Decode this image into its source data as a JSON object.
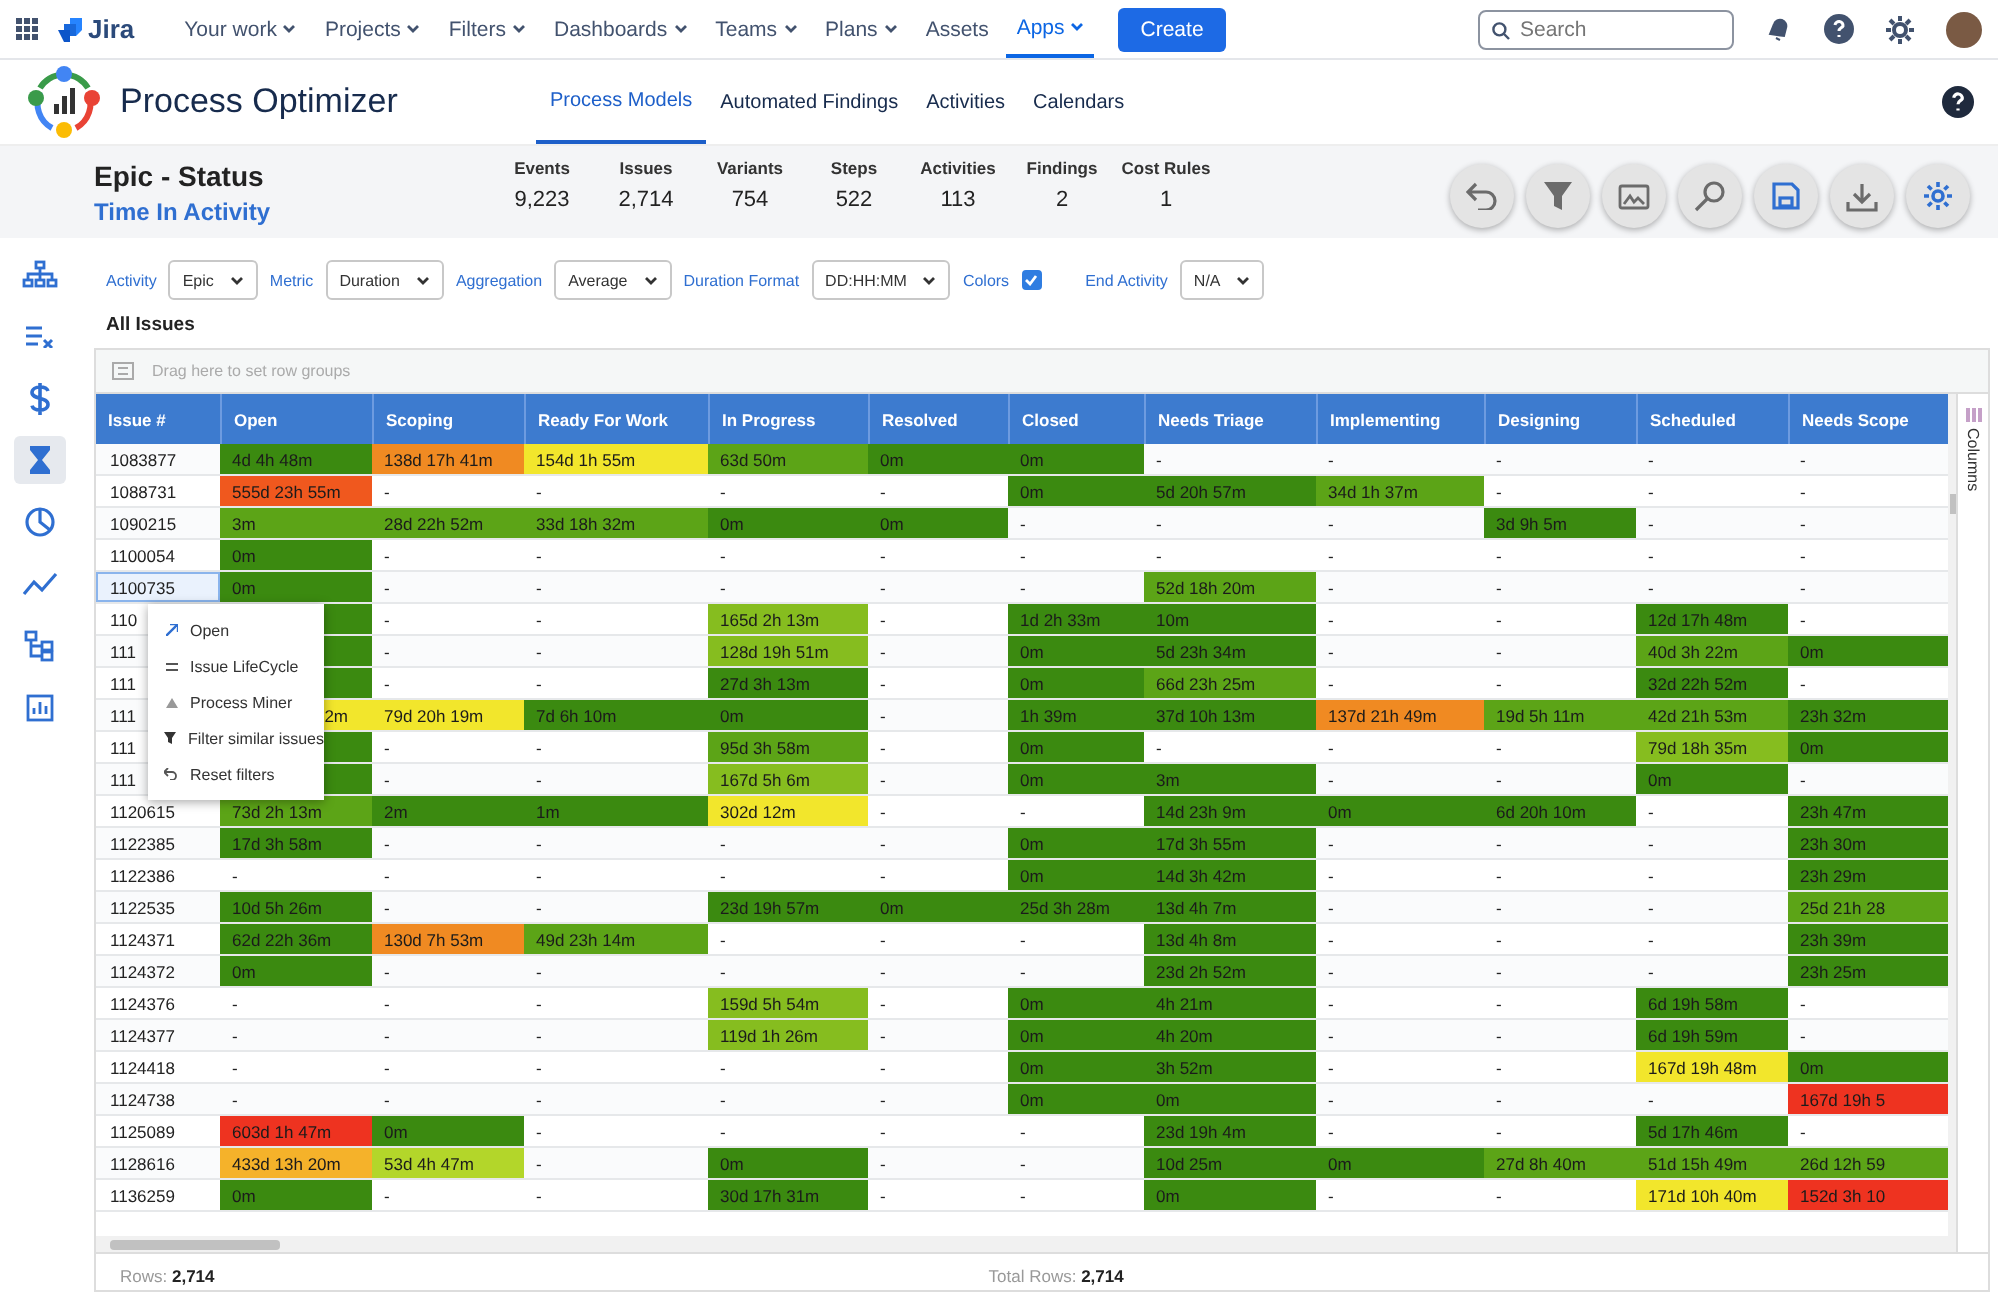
{
  "nav": {
    "product": "Jira",
    "items": [
      {
        "label": "Your work",
        "dropdown": true,
        "selected": false
      },
      {
        "label": "Projects",
        "dropdown": true,
        "selected": false
      },
      {
        "label": "Filters",
        "dropdown": true,
        "selected": false
      },
      {
        "label": "Dashboards",
        "dropdown": true,
        "selected": false
      },
      {
        "label": "Teams",
        "dropdown": true,
        "selected": false
      },
      {
        "label": "Plans",
        "dropdown": true,
        "selected": false
      },
      {
        "label": "Assets",
        "dropdown": false,
        "selected": false
      },
      {
        "label": "Apps",
        "dropdown": true,
        "selected": true
      }
    ],
    "create": "Create",
    "search": {
      "placeholder": "Search"
    }
  },
  "app": {
    "title": "Process Optimizer",
    "tabs": [
      {
        "label": "Process Models",
        "selected": true
      },
      {
        "label": "Automated Findings",
        "selected": false
      },
      {
        "label": "Activities",
        "selected": false
      },
      {
        "label": "Calendars",
        "selected": false
      }
    ]
  },
  "summary": {
    "title": "Epic - Status",
    "subtitle": "Time In Activity",
    "stats": [
      {
        "label": "Events",
        "value": "9,223"
      },
      {
        "label": "Issues",
        "value": "2,714"
      },
      {
        "label": "Variants",
        "value": "754"
      },
      {
        "label": "Steps",
        "value": "522"
      },
      {
        "label": "Activities",
        "value": "113"
      },
      {
        "label": "Findings",
        "value": "2"
      },
      {
        "label": "Cost Rules",
        "value": "1"
      }
    ]
  },
  "toolbar": [
    {
      "kind": "undo"
    },
    {
      "kind": "filter"
    },
    {
      "kind": "image"
    },
    {
      "kind": "magnifier"
    },
    {
      "kind": "save"
    },
    {
      "kind": "download"
    },
    {
      "kind": "settings"
    }
  ],
  "sidebar": {
    "items": [
      {
        "kind": "process-map",
        "selected": false
      },
      {
        "kind": "checklist",
        "selected": false
      },
      {
        "kind": "dollar",
        "selected": false
      },
      {
        "kind": "hourglass",
        "selected": true
      },
      {
        "kind": "pie",
        "selected": false
      },
      {
        "kind": "trend",
        "selected": false
      },
      {
        "kind": "hierarchy",
        "selected": false
      },
      {
        "kind": "report",
        "selected": false
      }
    ]
  },
  "filters": [
    {
      "kind": "select",
      "label": "Activity",
      "value": "Epic"
    },
    {
      "kind": "select",
      "label": "Metric",
      "value": "Duration"
    },
    {
      "kind": "select",
      "label": "Aggregation",
      "value": "Average"
    },
    {
      "kind": "select",
      "label": "Duration Format",
      "value": "DD:HH:MM"
    },
    {
      "kind": "checkbox",
      "label": "Colors",
      "checked": true
    },
    {
      "kind": "select",
      "label": "End Activity",
      "value": "N/A"
    }
  ],
  "section_title": "All Issues",
  "table": {
    "group_hint": "Drag here to set row groups",
    "side_panel": "Columns",
    "columns": [
      "Issue #",
      "Open",
      "Scoping",
      "Ready For Work",
      "In Progress",
      "Resolved",
      "Closed",
      "Needs Triage",
      "Implementing",
      "Designing",
      "Scheduled",
      "Needs Scope"
    ],
    "rows": [
      {
        "selected": false,
        "cells": [
          {
            "text": "1083877"
          },
          {
            "text": "4d 4h 48m",
            "color": "#3b8a10"
          },
          {
            "text": "138d 17h 41m",
            "color": "#f08a22"
          },
          {
            "text": "154d 1h 55m",
            "color": "#f2e62c"
          },
          {
            "text": "63d 50m",
            "color": "#5ca417"
          },
          {
            "text": "0m",
            "color": "#3b8a10"
          },
          {
            "text": "0m",
            "color": "#3b8a10"
          },
          {
            "text": "-"
          },
          {
            "text": "-"
          },
          {
            "text": "-"
          },
          {
            "text": "-"
          },
          {
            "text": "-"
          }
        ]
      },
      {
        "selected": false,
        "cells": [
          {
            "text": "1088731"
          },
          {
            "text": "555d 23h 55m",
            "color": "#f0581e"
          },
          {
            "text": "-"
          },
          {
            "text": "-"
          },
          {
            "text": "-"
          },
          {
            "text": "-"
          },
          {
            "text": "0m",
            "color": "#3b8a10"
          },
          {
            "text": "5d 20h 57m",
            "color": "#3b8a10"
          },
          {
            "text": "34d 1h 37m",
            "color": "#5ca417"
          },
          {
            "text": "-"
          },
          {
            "text": "-"
          },
          {
            "text": "-"
          }
        ]
      },
      {
        "selected": false,
        "cells": [
          {
            "text": "1090215"
          },
          {
            "text": "3m",
            "color": "#5ca417"
          },
          {
            "text": "28d 22h 52m",
            "color": "#5ca417"
          },
          {
            "text": "33d 18h 32m",
            "color": "#5ca417"
          },
          {
            "text": "0m",
            "color": "#3b8a10"
          },
          {
            "text": "0m",
            "color": "#3b8a10"
          },
          {
            "text": "-"
          },
          {
            "text": "-"
          },
          {
            "text": "-"
          },
          {
            "text": "3d 9h 5m",
            "color": "#3b8a10"
          },
          {
            "text": "-"
          },
          {
            "text": "-"
          }
        ]
      },
      {
        "selected": false,
        "cells": [
          {
            "text": "1100054"
          },
          {
            "text": "0m",
            "color": "#3b8a10"
          },
          {
            "text": "-"
          },
          {
            "text": "-"
          },
          {
            "text": "-"
          },
          {
            "text": "-"
          },
          {
            "text": "-"
          },
          {
            "text": "-"
          },
          {
            "text": "-"
          },
          {
            "text": "-"
          },
          {
            "text": "-"
          },
          {
            "text": "-"
          }
        ]
      },
      {
        "selected": true,
        "cells": [
          {
            "text": "1100735"
          },
          {
            "text": "0m",
            "color": "#3b8a10"
          },
          {
            "text": "-"
          },
          {
            "text": "-"
          },
          {
            "text": "-"
          },
          {
            "text": "-"
          },
          {
            "text": "-"
          },
          {
            "text": "52d 18h 20m",
            "color": "#5ca417"
          },
          {
            "text": "-"
          },
          {
            "text": "-"
          },
          {
            "text": "-"
          },
          {
            "text": "-"
          }
        ]
      },
      {
        "selected": false,
        "cells": [
          {
            "text": "110"
          },
          {
            "color": "#3b8a10"
          },
          {
            "text": "-"
          },
          {
            "text": "-"
          },
          {
            "text": "165d 2h 13m",
            "color": "#86bd1f"
          },
          {
            "text": "-"
          },
          {
            "text": "1d 2h 33m",
            "color": "#3b8a10"
          },
          {
            "text": "10m",
            "color": "#3b8a10"
          },
          {
            "text": "-"
          },
          {
            "text": "-"
          },
          {
            "text": "12d 17h 48m",
            "color": "#3b8a10"
          },
          {
            "text": "-"
          }
        ]
      },
      {
        "selected": false,
        "cells": [
          {
            "text": "111"
          },
          {
            "color": "#3b8a10"
          },
          {
            "text": "-"
          },
          {
            "text": "-"
          },
          {
            "text": "128d 19h 51m",
            "color": "#86bd1f"
          },
          {
            "text": "-"
          },
          {
            "text": "0m",
            "color": "#3b8a10"
          },
          {
            "text": "5d 23h 34m",
            "color": "#3b8a10"
          },
          {
            "text": "-"
          },
          {
            "text": "-"
          },
          {
            "text": "40d 3h 22m",
            "color": "#5ca417"
          },
          {
            "text": "0m",
            "color": "#3b8a10"
          }
        ]
      },
      {
        "selected": false,
        "cells": [
          {
            "text": "111"
          },
          {
            "color": "#3b8a10"
          },
          {
            "text": "-"
          },
          {
            "text": "-"
          },
          {
            "text": "27d 3h 13m",
            "color": "#3b8a10"
          },
          {
            "text": "-"
          },
          {
            "text": "0m",
            "color": "#3b8a10"
          },
          {
            "text": "66d 23h 25m",
            "color": "#5ca417"
          },
          {
            "text": "-"
          },
          {
            "text": "-"
          },
          {
            "text": "32d 22h 52m",
            "color": "#3b8a10"
          },
          {
            "text": "-"
          }
        ]
      },
      {
        "selected": false,
        "cells": [
          {
            "text": "111"
          },
          {
            "text": "2m",
            "color": "#f2e62c",
            "kind": "tail"
          },
          {
            "text": "79d 20h 19m",
            "color": "#f2e62c"
          },
          {
            "text": "7d 6h 10m",
            "color": "#3b8a10"
          },
          {
            "text": "0m",
            "color": "#3b8a10"
          },
          {
            "text": "-"
          },
          {
            "text": "1h 39m",
            "color": "#3b8a10"
          },
          {
            "text": "37d 10h 13m",
            "color": "#3b8a10"
          },
          {
            "text": "137d 21h 49m",
            "color": "#f08a22"
          },
          {
            "text": "19d 5h 11m",
            "color": "#5ca417"
          },
          {
            "text": "42d 21h 53m",
            "color": "#5ca417"
          },
          {
            "text": "23h 32m",
            "color": "#3b8a10"
          }
        ]
      },
      {
        "selected": false,
        "cells": [
          {
            "text": "111"
          },
          {
            "color": "#3b8a10"
          },
          {
            "text": "-"
          },
          {
            "text": "-"
          },
          {
            "text": "95d 3h 58m",
            "color": "#5ca417"
          },
          {
            "text": "-"
          },
          {
            "text": "0m",
            "color": "#3b8a10"
          },
          {
            "text": "-"
          },
          {
            "text": "-"
          },
          {
            "text": "-"
          },
          {
            "text": "79d 18h 35m",
            "color": "#86bd1f"
          },
          {
            "text": "0m",
            "color": "#3b8a10"
          }
        ]
      },
      {
        "selected": false,
        "cells": [
          {
            "text": "111"
          },
          {
            "color": "#3b8a10"
          },
          {
            "text": "-"
          },
          {
            "text": "-"
          },
          {
            "text": "167d 5h 6m",
            "color": "#86bd1f"
          },
          {
            "text": "-"
          },
          {
            "text": "0m",
            "color": "#3b8a10"
          },
          {
            "text": "3m",
            "color": "#3b8a10"
          },
          {
            "text": "-"
          },
          {
            "text": "-"
          },
          {
            "text": "0m",
            "color": "#3b8a10"
          },
          {
            "text": "-"
          }
        ]
      },
      {
        "selected": false,
        "cells": [
          {
            "text": "1120615"
          },
          {
            "text": "73d 2h 13m",
            "color": "#5ca417"
          },
          {
            "text": "2m",
            "color": "#3b8a10"
          },
          {
            "text": "1m",
            "color": "#3b8a10"
          },
          {
            "text": "302d 12m",
            "color": "#f2e62c"
          },
          {
            "text": "-"
          },
          {
            "text": "-"
          },
          {
            "text": "14d 23h 9m",
            "color": "#3b8a10"
          },
          {
            "text": "0m",
            "color": "#3b8a10"
          },
          {
            "text": "6d 20h 10m",
            "color": "#3b8a10"
          },
          {
            "text": "-"
          },
          {
            "text": "23h 47m",
            "color": "#3b8a10"
          }
        ]
      },
      {
        "selected": false,
        "cells": [
          {
            "text": "1122385"
          },
          {
            "text": "17d 3h 58m",
            "color": "#3b8a10"
          },
          {
            "text": "-"
          },
          {
            "text": "-"
          },
          {
            "text": "-"
          },
          {
            "text": "-"
          },
          {
            "text": "0m",
            "color": "#3b8a10"
          },
          {
            "text": "17d 3h 55m",
            "color": "#3b8a10"
          },
          {
            "text": "-"
          },
          {
            "text": "-"
          },
          {
            "text": "-"
          },
          {
            "text": "23h 30m",
            "color": "#3b8a10"
          }
        ]
      },
      {
        "selected": false,
        "cells": [
          {
            "text": "1122386"
          },
          {
            "text": "-"
          },
          {
            "text": "-"
          },
          {
            "text": "-"
          },
          {
            "text": "-"
          },
          {
            "text": "-"
          },
          {
            "text": "0m",
            "color": "#3b8a10"
          },
          {
            "text": "14d 3h 42m",
            "color": "#3b8a10"
          },
          {
            "text": "-"
          },
          {
            "text": "-"
          },
          {
            "text": "-"
          },
          {
            "text": "23h 29m",
            "color": "#3b8a10"
          }
        ]
      },
      {
        "selected": false,
        "cells": [
          {
            "text": "1122535"
          },
          {
            "text": "10d 5h 26m",
            "color": "#3b8a10"
          },
          {
            "text": "-"
          },
          {
            "text": "-"
          },
          {
            "text": "23d 19h 57m",
            "color": "#3b8a10"
          },
          {
            "text": "0m",
            "color": "#3b8a10"
          },
          {
            "text": "25d 3h 28m",
            "color": "#3b8a10"
          },
          {
            "text": "13d 4h 7m",
            "color": "#3b8a10"
          },
          {
            "text": "-"
          },
          {
            "text": "-"
          },
          {
            "text": "-"
          },
          {
            "text": "25d 21h 28",
            "color": "#5ca417"
          }
        ]
      },
      {
        "selected": false,
        "cells": [
          {
            "text": "1124371"
          },
          {
            "text": "62d 22h 36m",
            "color": "#3b8a10"
          },
          {
            "text": "130d 7h 53m",
            "color": "#f08a22"
          },
          {
            "text": "49d 23h 14m",
            "color": "#5ca417"
          },
          {
            "text": "-"
          },
          {
            "text": "-"
          },
          {
            "text": "-"
          },
          {
            "text": "13d 4h 8m",
            "color": "#3b8a10"
          },
          {
            "text": "-"
          },
          {
            "text": "-"
          },
          {
            "text": "-"
          },
          {
            "text": "23h 39m",
            "color": "#3b8a10"
          }
        ]
      },
      {
        "selected": false,
        "cells": [
          {
            "text": "1124372"
          },
          {
            "text": "0m",
            "color": "#3b8a10"
          },
          {
            "text": "-"
          },
          {
            "text": "-"
          },
          {
            "text": "-"
          },
          {
            "text": "-"
          },
          {
            "text": "-"
          },
          {
            "text": "23d 2h 52m",
            "color": "#3b8a10"
          },
          {
            "text": "-"
          },
          {
            "text": "-"
          },
          {
            "text": "-"
          },
          {
            "text": "23h 25m",
            "color": "#3b8a10"
          }
        ]
      },
      {
        "selected": false,
        "cells": [
          {
            "text": "1124376"
          },
          {
            "text": "-"
          },
          {
            "text": "-"
          },
          {
            "text": "-"
          },
          {
            "text": "159d 5h 54m",
            "color": "#86bd1f"
          },
          {
            "text": "-"
          },
          {
            "text": "0m",
            "color": "#3b8a10"
          },
          {
            "text": "4h 21m",
            "color": "#3b8a10"
          },
          {
            "text": "-"
          },
          {
            "text": "-"
          },
          {
            "text": "6d 19h 58m",
            "color": "#3b8a10"
          },
          {
            "text": "-"
          }
        ]
      },
      {
        "selected": false,
        "cells": [
          {
            "text": "1124377"
          },
          {
            "text": "-"
          },
          {
            "text": "-"
          },
          {
            "text": "-"
          },
          {
            "text": "119d 1h 26m",
            "color": "#86bd1f"
          },
          {
            "text": "-"
          },
          {
            "text": "0m",
            "color": "#3b8a10"
          },
          {
            "text": "4h 20m",
            "color": "#3b8a10"
          },
          {
            "text": "-"
          },
          {
            "text": "-"
          },
          {
            "text": "6d 19h 59m",
            "color": "#3b8a10"
          },
          {
            "text": "-"
          }
        ]
      },
      {
        "selected": false,
        "cells": [
          {
            "text": "1124418"
          },
          {
            "text": "-"
          },
          {
            "text": "-"
          },
          {
            "text": "-"
          },
          {
            "text": "-"
          },
          {
            "text": "-"
          },
          {
            "text": "0m",
            "color": "#3b8a10"
          },
          {
            "text": "3h 52m",
            "color": "#3b8a10"
          },
          {
            "text": "-"
          },
          {
            "text": "-"
          },
          {
            "text": "167d 19h 48m",
            "color": "#f2e62c"
          },
          {
            "text": "0m",
            "color": "#3b8a10"
          }
        ]
      },
      {
        "selected": false,
        "cells": [
          {
            "text": "1124738"
          },
          {
            "text": "-"
          },
          {
            "text": "-"
          },
          {
            "text": "-"
          },
          {
            "text": "-"
          },
          {
            "text": "-"
          },
          {
            "text": "0m",
            "color": "#3b8a10"
          },
          {
            "text": "0m",
            "color": "#3b8a10"
          },
          {
            "text": "-"
          },
          {
            "text": "-"
          },
          {
            "text": "-"
          },
          {
            "text": "167d 19h 5",
            "color": "#ee3320"
          }
        ]
      },
      {
        "selected": false,
        "cells": [
          {
            "text": "1125089"
          },
          {
            "text": "603d 1h 47m",
            "color": "#ee3320"
          },
          {
            "text": "0m",
            "color": "#3b8a10"
          },
          {
            "text": "-"
          },
          {
            "text": "-"
          },
          {
            "text": "-"
          },
          {
            "text": "-"
          },
          {
            "text": "23d 19h 4m",
            "color": "#3b8a10"
          },
          {
            "text": "-"
          },
          {
            "text": "-"
          },
          {
            "text": "5d 17h 46m",
            "color": "#3b8a10"
          },
          {
            "text": "-"
          }
        ]
      },
      {
        "selected": false,
        "cells": [
          {
            "text": "1128616"
          },
          {
            "text": "433d 13h 20m",
            "color": "#f5b22a"
          },
          {
            "text": "53d 4h 47m",
            "color": "#b3d62a"
          },
          {
            "text": "-"
          },
          {
            "text": "0m",
            "color": "#3b8a10"
          },
          {
            "text": "-"
          },
          {
            "text": "-"
          },
          {
            "text": "10d 25m",
            "color": "#3b8a10"
          },
          {
            "text": "0m",
            "color": "#3b8a10"
          },
          {
            "text": "27d 8h 40m",
            "color": "#5ca417"
          },
          {
            "text": "51d 15h 49m",
            "color": "#5ca417"
          },
          {
            "text": "26d 12h 59",
            "color": "#5ca417"
          }
        ]
      },
      {
        "selected": false,
        "cells": [
          {
            "text": "1136259"
          },
          {
            "text": "0m",
            "color": "#3b8a10"
          },
          {
            "text": "-"
          },
          {
            "text": "-"
          },
          {
            "text": "30d 17h 31m",
            "color": "#3b8a10"
          },
          {
            "text": "-"
          },
          {
            "text": "-"
          },
          {
            "text": "0m",
            "color": "#3b8a10"
          },
          {
            "text": "-"
          },
          {
            "text": "-"
          },
          {
            "text": "171d 10h 40m",
            "color": "#f2e62c"
          },
          {
            "text": "152d 3h 10",
            "color": "#ee3320"
          }
        ]
      }
    ],
    "footer": {
      "rows": "Rows: **2,714**",
      "total": "Total Rows: **2,714**"
    }
  },
  "context_menu": [
    {
      "kind": "open",
      "label": "Open"
    },
    {
      "kind": "lifecycle",
      "label": "Issue LifeCycle"
    },
    {
      "kind": "miner",
      "label": "Process Miner"
    },
    {
      "kind": "filter",
      "label": "Filter similar issues"
    },
    {
      "kind": "reset",
      "label": "Reset filters"
    }
  ]
}
